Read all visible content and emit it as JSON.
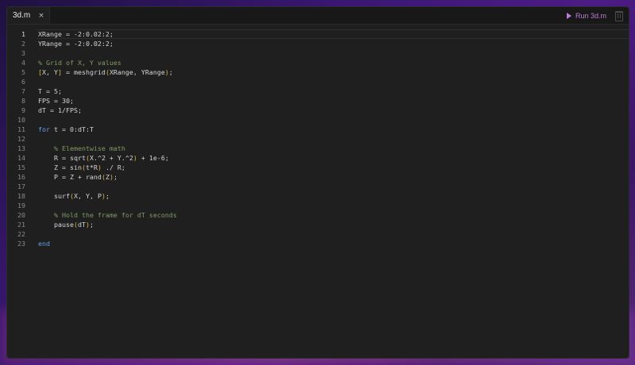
{
  "tab": {
    "label": "3d.m",
    "close_glyph": "×"
  },
  "toolbar": {
    "run_label": "Run 3d.m",
    "run_icon": "play-icon",
    "trash_icon": "trash-icon"
  },
  "colors": {
    "accent": "#c07bd8",
    "comment": "#7f9a64",
    "keyword": "#6a9fe0",
    "bracket": "#d8b84a",
    "editor_bg": "#1f1f1f"
  },
  "editor": {
    "active_line": 1,
    "lines": [
      {
        "n": "1",
        "tokens": [
          [
            "XRange = -2:0.02:2;",
            "plain"
          ]
        ]
      },
      {
        "n": "2",
        "tokens": [
          [
            "YRange = -2:0.02:2;",
            "plain"
          ]
        ]
      },
      {
        "n": "3",
        "tokens": []
      },
      {
        "n": "4",
        "tokens": [
          [
            "% Grid of X, Y values",
            "comment"
          ]
        ]
      },
      {
        "n": "5",
        "tokens": [
          [
            "[",
            "bracket"
          ],
          [
            "X, Y",
            "plain"
          ],
          [
            "]",
            "bracket"
          ],
          [
            " = meshgrid",
            "plain"
          ],
          [
            "(",
            "bracket"
          ],
          [
            "XRange, YRange",
            "plain"
          ],
          [
            ")",
            "bracket"
          ],
          [
            ";",
            "plain"
          ]
        ]
      },
      {
        "n": "6",
        "tokens": []
      },
      {
        "n": "7",
        "tokens": [
          [
            "T = 5;",
            "plain"
          ]
        ]
      },
      {
        "n": "8",
        "tokens": [
          [
            "FPS = 30;",
            "plain"
          ]
        ]
      },
      {
        "n": "9",
        "tokens": [
          [
            "dT = 1/FPS;",
            "plain"
          ]
        ]
      },
      {
        "n": "10",
        "tokens": []
      },
      {
        "n": "11",
        "tokens": [
          [
            "for",
            "keyword"
          ],
          [
            " t = 0:dT:T",
            "plain"
          ]
        ]
      },
      {
        "n": "12",
        "tokens": []
      },
      {
        "n": "13",
        "tokens": [
          [
            "    ",
            "plain"
          ],
          [
            "% Elementwise math",
            "comment"
          ]
        ]
      },
      {
        "n": "14",
        "tokens": [
          [
            "    R = sqrt",
            "plain"
          ],
          [
            "(",
            "bracket"
          ],
          [
            "X.^2 + Y.^2",
            "plain"
          ],
          [
            ")",
            "bracket"
          ],
          [
            " + 1e-6;",
            "plain"
          ]
        ]
      },
      {
        "n": "15",
        "tokens": [
          [
            "    Z = sin",
            "plain"
          ],
          [
            "(",
            "bracket"
          ],
          [
            "t*R",
            "plain"
          ],
          [
            ")",
            "bracket"
          ],
          [
            " ./ R;",
            "plain"
          ]
        ]
      },
      {
        "n": "16",
        "tokens": [
          [
            "    P = Z + rand",
            "plain"
          ],
          [
            "(",
            "bracket"
          ],
          [
            "Z",
            "plain"
          ],
          [
            ")",
            "bracket"
          ],
          [
            ";",
            "plain"
          ]
        ]
      },
      {
        "n": "17",
        "tokens": []
      },
      {
        "n": "18",
        "tokens": [
          [
            "    surf",
            "plain"
          ],
          [
            "(",
            "bracket"
          ],
          [
            "X, Y, P",
            "plain"
          ],
          [
            ")",
            "bracket"
          ],
          [
            ";",
            "plain"
          ]
        ]
      },
      {
        "n": "19",
        "tokens": []
      },
      {
        "n": "20",
        "tokens": [
          [
            "    ",
            "plain"
          ],
          [
            "% Hold the frame for dT seconds",
            "comment"
          ]
        ]
      },
      {
        "n": "21",
        "tokens": [
          [
            "    pause",
            "plain"
          ],
          [
            "(",
            "bracket"
          ],
          [
            "dT",
            "plain"
          ],
          [
            ")",
            "bracket"
          ],
          [
            ";",
            "plain"
          ]
        ]
      },
      {
        "n": "22",
        "tokens": []
      },
      {
        "n": "23",
        "tokens": [
          [
            "end",
            "keyword"
          ]
        ]
      }
    ]
  }
}
